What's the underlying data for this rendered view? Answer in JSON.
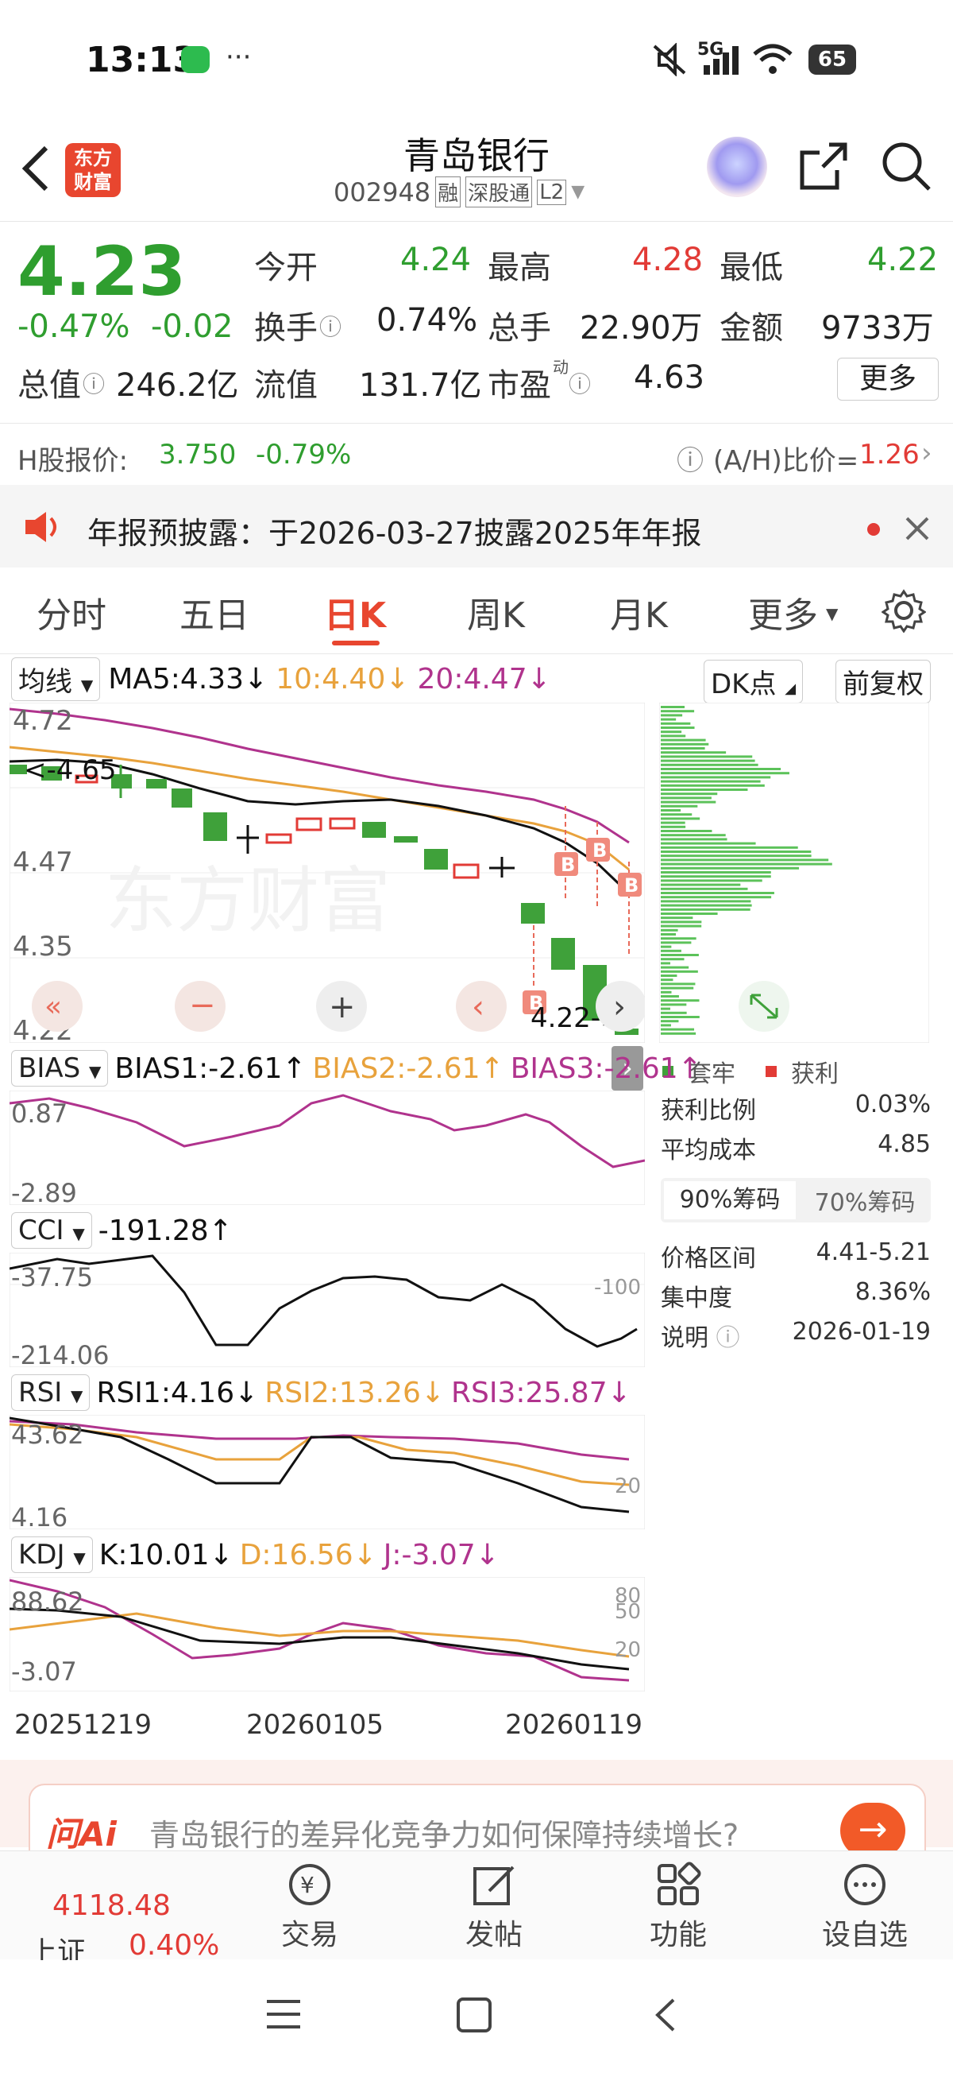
{
  "status": {
    "time": "13:13",
    "more": "···",
    "network": "5G",
    "battery": "65"
  },
  "header": {
    "back_icon": "chevron-left",
    "logo_line1": "东方",
    "logo_line2": "财富",
    "stock_name": "青岛银行",
    "stock_code": "002948",
    "tag_margin": "融",
    "tag_connect": "深股通",
    "tag_level": "L2"
  },
  "quote": {
    "price": "4.23",
    "change_pct": "-0.47%",
    "change_abs": "-0.02",
    "open_label": "今开",
    "open": "4.24",
    "high_label": "最高",
    "high": "4.28",
    "low_label": "最低",
    "low": "4.22",
    "turnover_label": "换手",
    "turnover": "0.74%",
    "volume_label": "总手",
    "volume": "22.90万",
    "amount_label": "金额",
    "amount": "9733万",
    "mktcap_label": "总值",
    "mktcap": "246.2亿",
    "float_label": "流值",
    "float": "131.7亿",
    "pe_label": "市盈",
    "pe_sup": "动",
    "pe": "4.63",
    "more_label": "更多"
  },
  "hshare": {
    "label": "H股报价:",
    "price": "3.750",
    "change": "-0.79%",
    "ah_label": "(A/H)比价=",
    "ah_value": "1.26"
  },
  "notice": {
    "text": "年报预披露：于2026-03-27披露2025年年报"
  },
  "tabs": [
    "分时",
    "五日",
    "日K",
    "周K",
    "月K",
    "更多"
  ],
  "active_tab": "日K",
  "kline": {
    "ma_select": "均线",
    "ma5": "MA5:4.33↓",
    "ma10": "10:4.40↓",
    "ma20": "20:4.47↓",
    "dk_label": "DK点",
    "adjust_label": "前复权",
    "y_labels": [
      "4.72",
      "4.47",
      "4.35",
      "4.22"
    ],
    "max_marker": "<-4.65",
    "min_marker": "4.22->",
    "buy_marker": "B",
    "colors": {
      "up": "#e23b36",
      "down": "#3fa13a",
      "ma5": "#111111",
      "ma10": "#e8a23c",
      "ma20": "#b0338d"
    }
  },
  "chip": {
    "legend_trapped": "套牢",
    "legend_profit": "获利",
    "profit_ratio_label": "获利比例",
    "profit_ratio": "0.03%",
    "avg_cost_label": "平均成本",
    "avg_cost": "4.85",
    "tab90": "90%筹码",
    "tab70": "70%筹码",
    "range_label": "价格区间",
    "range": "4.41-5.21",
    "concentration_label": "集中度",
    "concentration": "8.36%",
    "note_label": "说明",
    "note_date": "2026-01-19"
  },
  "bias": {
    "name": "BIAS",
    "b1": "BIAS1:-2.61↑",
    "b2": "BIAS2:-2.61↑",
    "b3": "BIAS3:-2.61↑",
    "y_top": "0.87",
    "y_bottom": "-2.89"
  },
  "cci": {
    "name": "CCI",
    "value": "-191.28↑",
    "y_top": "-37.75",
    "y_bottom": "-214.06",
    "ref": "-100"
  },
  "rsi": {
    "name": "RSI",
    "r1": "RSI1:4.16↓",
    "r2": "RSI2:13.26↓",
    "r3": "RSI3:25.87↓",
    "y_top": "43.62",
    "y_bottom": "4.16",
    "ref": "20"
  },
  "kdj": {
    "name": "KDJ",
    "k": "K:10.01↓",
    "d": "D:16.56↓",
    "j": "J:-3.07↓",
    "y_top": "88.62",
    "y_bottom": "-3.07",
    "ref80": "80",
    "ref50": "50",
    "ref20": "20"
  },
  "dates": [
    "20251219",
    "20260105",
    "20260119"
  ],
  "ai": {
    "brand": "问Ai",
    "prompt": "青岛银行的差异化竞争力如何保障持续增长?"
  },
  "bottom_nav": {
    "index_value": "4118.48",
    "index_name": "上证",
    "index_change": "0.40%",
    "trade": "交易",
    "post": "发帖",
    "func": "功能",
    "watch": "设自选"
  }
}
